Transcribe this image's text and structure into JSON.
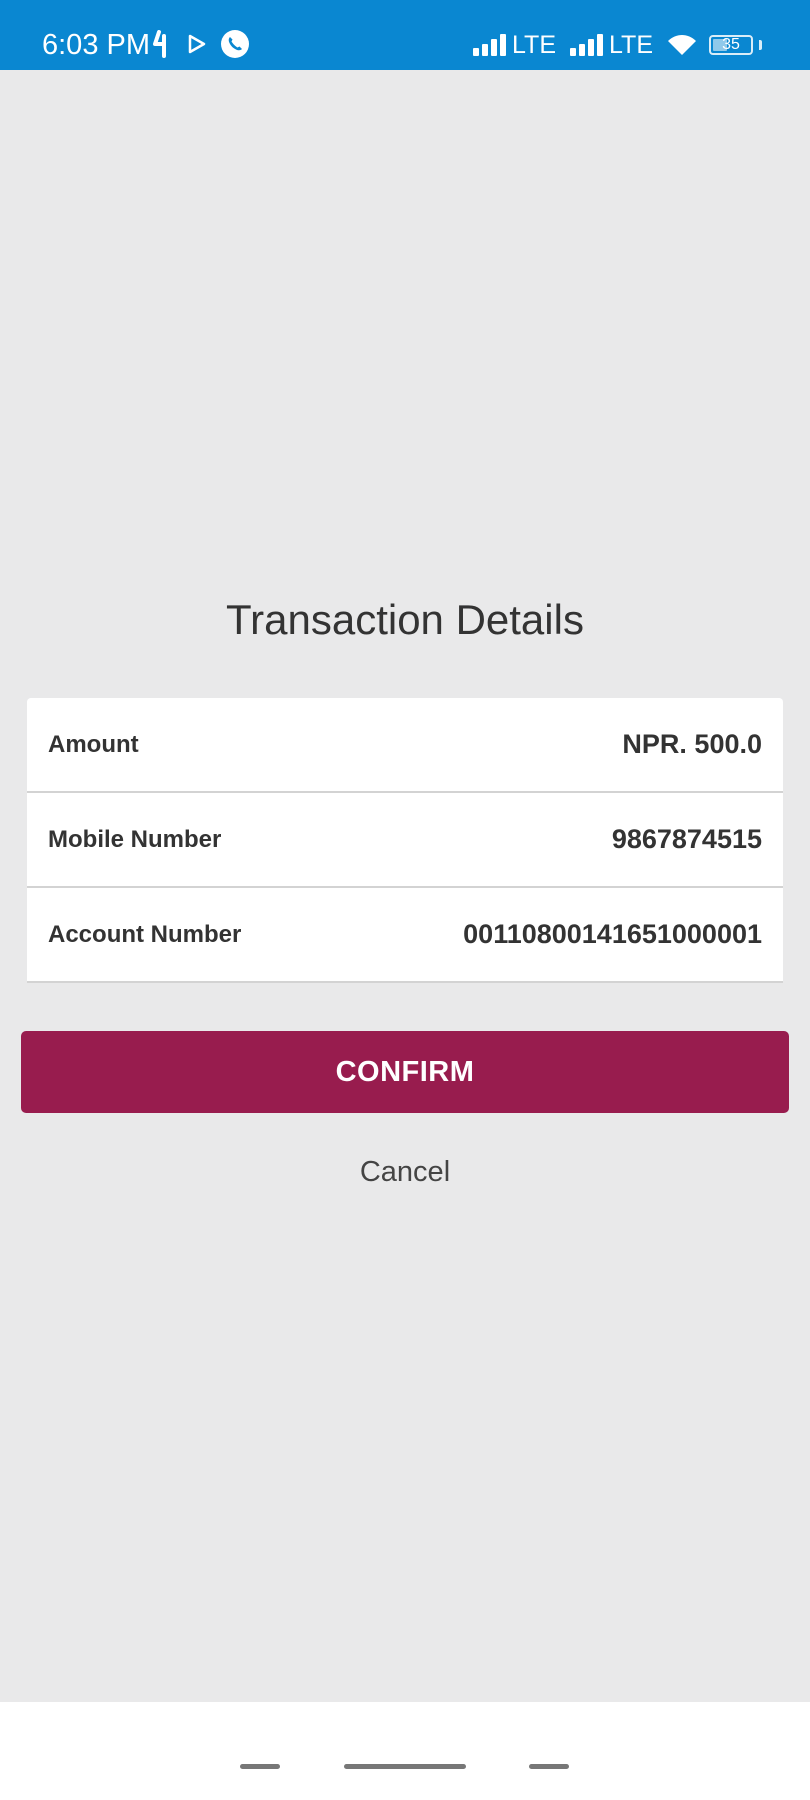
{
  "status_bar": {
    "time": "6:03 PM",
    "network_1": "LTE",
    "network_2": "LTE",
    "battery_level": "35",
    "left_icons": [
      "carrier-glyph-icon",
      "play-store-icon",
      "phone-call-icon"
    ],
    "right_icons": [
      "signal-icon",
      "signal-icon",
      "wifi-icon",
      "battery-icon"
    ],
    "color": "#0a87d1"
  },
  "dialog": {
    "title": "Transaction Details",
    "rows": [
      {
        "label": "Amount",
        "value": "NPR. 500.0"
      },
      {
        "label": "Mobile Number",
        "value": "9867874515"
      },
      {
        "label": "Account Number",
        "value": "00110800141651000001"
      }
    ],
    "confirm_label": "CONFIRM",
    "cancel_label": "Cancel",
    "accent_color": "#981c4e"
  },
  "nav_bar": {
    "icons": [
      "recent-apps-icon",
      "home-icon",
      "back-icon"
    ]
  }
}
